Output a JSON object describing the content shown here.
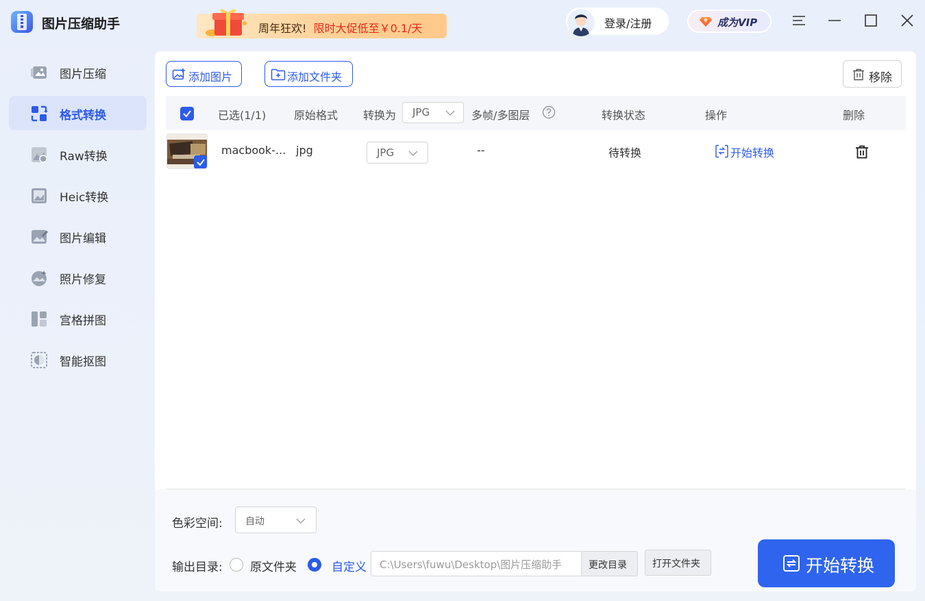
{
  "app": {
    "title": "图片压缩助手"
  },
  "promo": {
    "text_a": "周年狂欢!",
    "text_b": "限时大促低至￥0.1/天"
  },
  "header": {
    "login_label": "登录/注册",
    "vip_label": "成为VIP"
  },
  "sidebar": {
    "items": [
      {
        "label": "图片压缩",
        "icon": "image-compress-icon",
        "active": false
      },
      {
        "label": "格式转换",
        "icon": "format-convert-icon",
        "active": true
      },
      {
        "label": "Raw转换",
        "icon": "raw-convert-icon",
        "active": false
      },
      {
        "label": "Heic转换",
        "icon": "heic-convert-icon",
        "active": false
      },
      {
        "label": "图片编辑",
        "icon": "image-edit-icon",
        "active": false
      },
      {
        "label": "照片修复",
        "icon": "photo-repair-icon",
        "active": false
      },
      {
        "label": "宫格拼图",
        "icon": "grid-collage-icon",
        "active": false
      },
      {
        "label": "智能抠图",
        "icon": "smart-cutout-icon",
        "active": false
      }
    ]
  },
  "toolbar": {
    "add_image": "添加图片",
    "add_folder": "添加文件夹",
    "remove": "移除"
  },
  "table": {
    "headers": {
      "selected": "已选(1/1)",
      "original_format": "原始格式",
      "convert_to": "转换为",
      "convert_to_value": "JPG",
      "multi_frame": "多帧/多图层",
      "status": "转换状态",
      "action": "操作",
      "delete": "删除"
    },
    "rows": [
      {
        "name": "macbook-...",
        "format": "jpg",
        "target": "JPG",
        "multi_frame": "--",
        "status": "待转换",
        "action": "开始转换",
        "checked": true
      }
    ]
  },
  "footer": {
    "color_space_label": "色彩空间:",
    "color_space_value": "自动",
    "output_label": "输出目录:",
    "option_original": "原文件夹",
    "option_custom": "自定义",
    "selected_option": "custom",
    "path": "C:\\Users\\fuwu\\Desktop\\图片压缩助手",
    "change_dir": "更改目录",
    "open_folder": "打开文件夹",
    "start": "开始转换"
  },
  "colors": {
    "accent": "#2c5be8",
    "start_button": "#2f64ee",
    "promo_red": "#e8271a"
  }
}
